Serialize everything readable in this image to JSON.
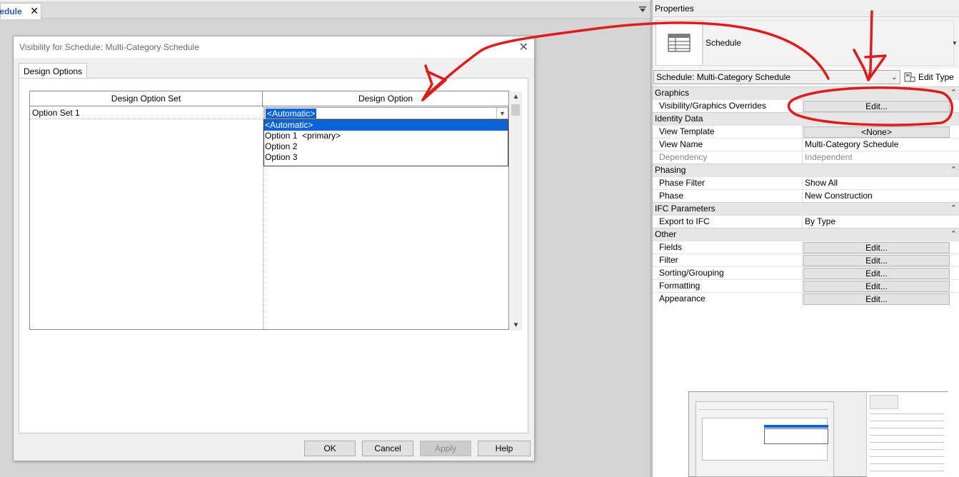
{
  "workspace": {
    "tab_label": "hedule"
  },
  "dialog": {
    "title": "Visibility for Schedule: Multi-Category Schedule",
    "tab_label": "Design Options",
    "grid": {
      "columns": [
        "Design Option Set",
        "Design Option"
      ],
      "rows": [
        {
          "set": "Option Set 1",
          "option": "<Automatic>"
        }
      ],
      "dropdown_options": [
        "<Automatic>",
        "Option 1  <primary>",
        "Option 2",
        "Option 3"
      ],
      "selected_option": "<Automatic>"
    },
    "buttons": {
      "ok": "OK",
      "cancel": "Cancel",
      "apply": "Apply",
      "help": "Help"
    },
    "apply_enabled": false
  },
  "properties": {
    "header": "Properties",
    "type_name": "Schedule",
    "instance_selector": "Schedule: Multi-Category Schedule",
    "edit_type_label": "Edit Type",
    "groups": {
      "graphics": "Graphics",
      "identity": "Identity Data",
      "phasing": "Phasing",
      "ifc": "IFC Parameters",
      "other": "Other"
    },
    "rows": {
      "vg_overrides": {
        "label": "Visibility/Graphics Overrides",
        "value": "Edit..."
      },
      "view_template": {
        "label": "View Template",
        "value": "<None>"
      },
      "view_name": {
        "label": "View Name",
        "value": "Multi-Category Schedule"
      },
      "dependency": {
        "label": "Dependency",
        "value": "Independent"
      },
      "phase_filter": {
        "label": "Phase Filter",
        "value": "Show All"
      },
      "phase": {
        "label": "Phase",
        "value": "New Construction"
      },
      "export_ifc": {
        "label": "Export to IFC",
        "value": "By Type"
      },
      "fields": {
        "label": "Fields",
        "value": "Edit..."
      },
      "filter": {
        "label": "Filter",
        "value": "Edit..."
      },
      "sorting": {
        "label": "Sorting/Grouping",
        "value": "Edit..."
      },
      "formatting": {
        "label": "Formatting",
        "value": "Edit..."
      },
      "appearance": {
        "label": "Appearance",
        "value": "Edit..."
      }
    }
  },
  "colors": {
    "selection_blue": "#0a64d8",
    "annotation_red": "#e01b1b",
    "tab_text_blue": "#2a5aa6"
  },
  "icons": [
    "close-icon",
    "panel-menu-icon",
    "dropdown-arrow-icon",
    "scroll-up-icon",
    "scroll-down-icon",
    "schedule-table-icon",
    "edit-type-icon",
    "collapse-icon"
  ]
}
